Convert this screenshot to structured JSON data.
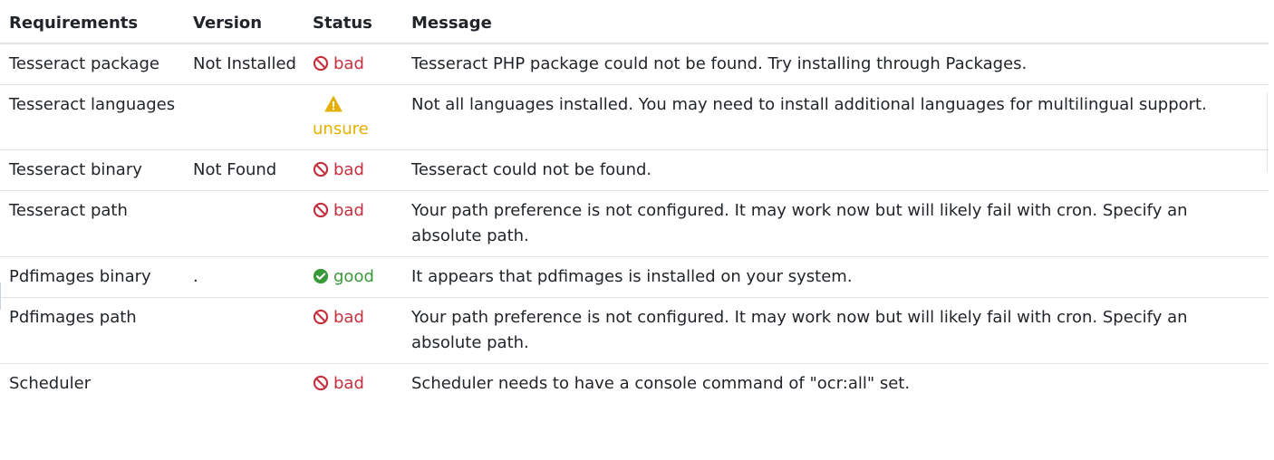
{
  "table": {
    "headers": {
      "requirements": "Requirements",
      "version": "Version",
      "status": "Status",
      "message": "Message"
    },
    "rows": [
      {
        "requirement": "Tesseract package",
        "version": "Not Installed",
        "status": "bad",
        "message": "Tesseract PHP package could not be found. Try installing through Packages."
      },
      {
        "requirement": "Tesseract languages",
        "version": "",
        "status": "unsure",
        "message": "Not all languages installed. You may need to install additional languages for multilingual support."
      },
      {
        "requirement": "Tesseract binary",
        "version": "Not Found",
        "status": "bad",
        "message": "Tesseract could not be found."
      },
      {
        "requirement": "Tesseract path",
        "version": "",
        "status": "bad",
        "message": "Your path preference is not configured. It may work now but will likely fail with cron. Specify an absolute path."
      },
      {
        "requirement": "Pdfimages binary",
        "version": ".",
        "status": "good",
        "message": "It appears that pdfimages is installed on your system."
      },
      {
        "requirement": "Pdfimages path",
        "version": "",
        "status": "bad",
        "message": "Your path preference is not configured. It may work now but will likely fail with cron. Specify an absolute path."
      },
      {
        "requirement": "Scheduler",
        "version": "",
        "status": "bad",
        "message": "Scheduler needs to have a console command of \"ocr:all\" set."
      }
    ]
  },
  "status_icons": {
    "bad": "ban-icon",
    "good": "check-circle-icon",
    "unsure": "warning-triangle-icon"
  },
  "colors": {
    "bad": "#c5303f",
    "good": "#3a9a3a",
    "unsure": "#e6b000",
    "text": "#212529",
    "border": "#dee2e6"
  }
}
